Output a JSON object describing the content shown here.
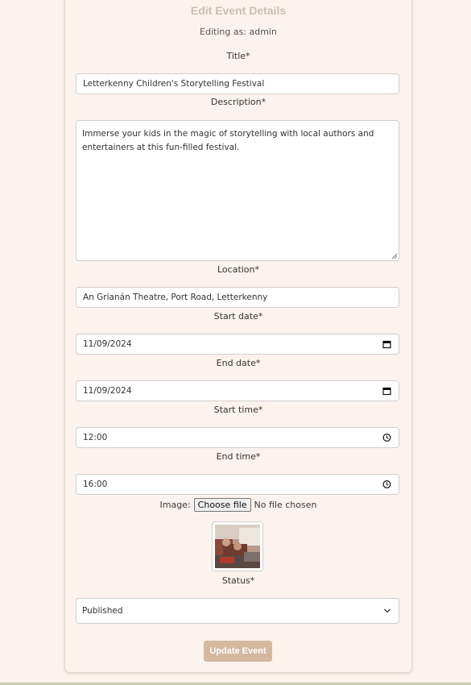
{
  "form": {
    "heading": "Edit Event Details",
    "editing_as": "Editing as: admin",
    "title_label": "Title*",
    "title_value": "Letterkenny Children's Storytelling Festival",
    "description_label": "Description*",
    "description_value": "Immerse your kids in the magic of storytelling with local authors and entertainers at this fun-filled festival.",
    "location_label": "Location*",
    "location_value": "An Grianán Theatre, Port Road, Letterkenny",
    "start_date_label": "Start date*",
    "start_date_value": "11/09/2024",
    "end_date_label": "End date*",
    "end_date_value": "11/09/2024",
    "start_time_label": "Start time*",
    "start_time_value": "12:00",
    "end_time_label": "End time*",
    "end_time_value": "16:00",
    "image_label": "Image:",
    "choose_file_label": "Choose file",
    "no_file_text": "No file chosen",
    "status_label": "Status*",
    "status_value": "Published",
    "submit_label": "Update Event"
  },
  "icons": {
    "date": "calendar-icon",
    "time": "clock-icon",
    "select": "chevron-down-icon"
  },
  "colors": {
    "background": "#fcf2ee",
    "heading": "#c5c1b6",
    "button": "#d4b8a0"
  }
}
